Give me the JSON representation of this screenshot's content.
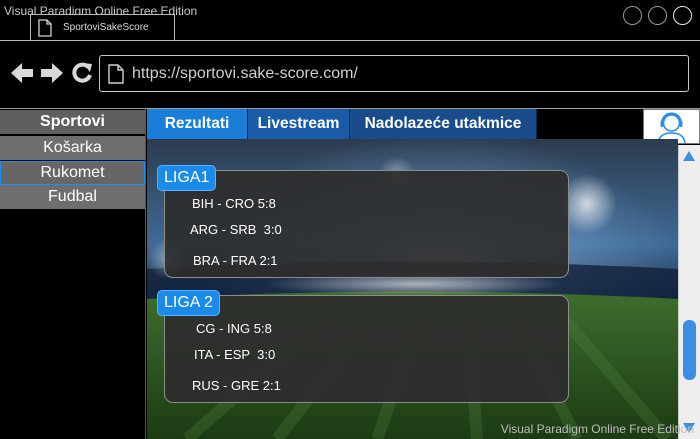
{
  "watermark": "Visual Paradigm Online Free Edition",
  "browser": {
    "tab_title": "SportoviSakeScore",
    "url": "https://sportovi.sake-score.com/"
  },
  "sidebar": {
    "items": [
      {
        "label": "Sportovi"
      },
      {
        "label": "Košarka"
      },
      {
        "label": "Rukomet"
      },
      {
        "label": "Fudbal"
      }
    ]
  },
  "menu": {
    "items": [
      {
        "label": "Rezultati"
      },
      {
        "label": "Livestream"
      },
      {
        "label": "Nadolazeće utakmice"
      }
    ]
  },
  "leagues": [
    {
      "title": "LIGA1",
      "matches": [
        "BIH - CRO 5:8",
        "ARG - SRB  3:0",
        "BRA - FRA 2:1"
      ]
    },
    {
      "title": "LIGA 2",
      "matches": [
        "CG - ING 5:8",
        "ITA - ESP  3:0",
        "RUS - GRE 2:1"
      ]
    }
  ],
  "colors": {
    "accent": "#1a8bea",
    "tab_active": "#1a7ed9",
    "tab_2": "#1a5ba8",
    "tab_3": "#1a4b8a",
    "sidebar_item": "#6e6e6e"
  }
}
